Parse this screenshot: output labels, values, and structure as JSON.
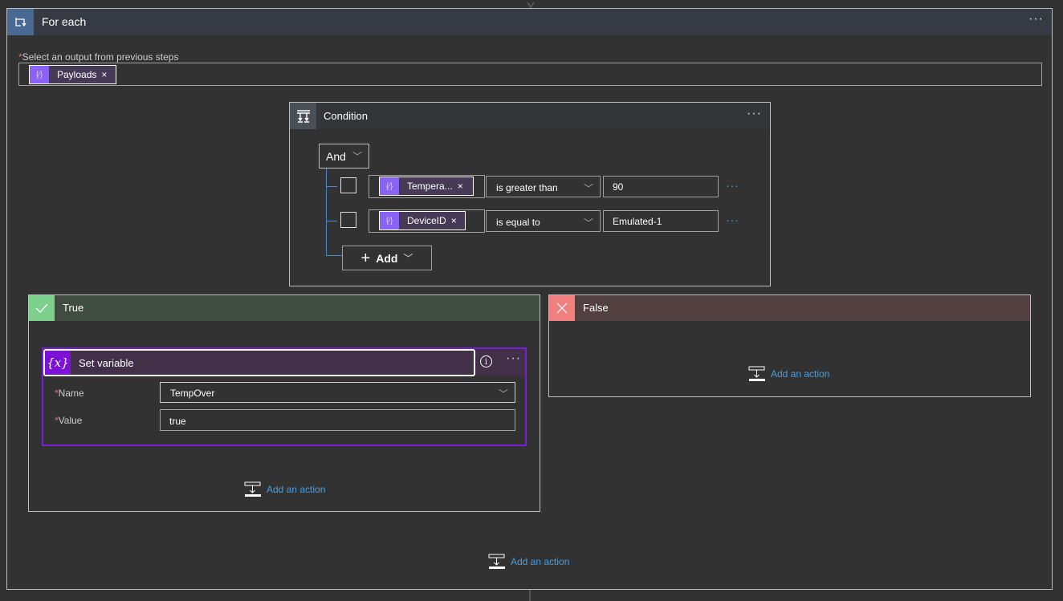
{
  "foreach": {
    "title": "For each",
    "icon": "loop-icon",
    "more_label": "···",
    "field_label": "Select an output from previous steps",
    "required_mark": "*",
    "token": {
      "icon": "expression-icon",
      "label": "Payloads",
      "remove": "×"
    }
  },
  "condition": {
    "title": "Condition",
    "icon": "condition-icon",
    "more_label": "···",
    "group_operator": "And",
    "rows": [
      {
        "token": "Tempera...",
        "remove": "×",
        "operator": "is greater than",
        "value": "90",
        "more": "···"
      },
      {
        "token": "DeviceID",
        "remove": "×",
        "operator": "is equal to",
        "value": "Emulated-1",
        "more": "···"
      }
    ],
    "add_label": "Add"
  },
  "true_branch": {
    "title": "True",
    "icon": "check-icon",
    "action": {
      "title": "Set variable",
      "icon_text": "{x}",
      "more_label": "···",
      "fields": [
        {
          "label": "Name",
          "required": "*",
          "value": "TempOver"
        },
        {
          "label": "Value",
          "required": "*",
          "value": "true"
        }
      ]
    },
    "add_action_label": "Add an action"
  },
  "false_branch": {
    "title": "False",
    "icon": "close-icon",
    "add_action_label": "Add an action"
  },
  "foreach_add_action_label": "Add an action",
  "colors": {
    "foreach_accent": "#486991",
    "true_accent": "#7dcf8c",
    "false_accent": "#f08080",
    "variable_accent": "#7b12d6",
    "token_accent": "#8b63f4",
    "link": "#4a9ee0"
  }
}
